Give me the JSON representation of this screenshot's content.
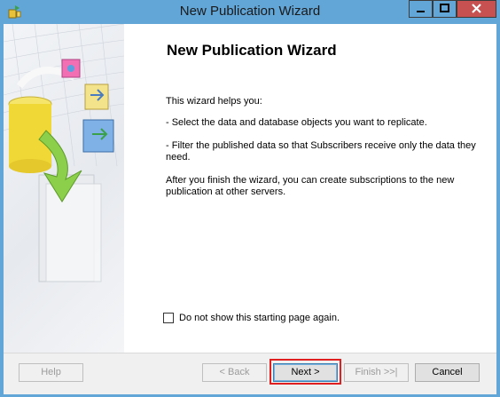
{
  "window": {
    "title": "New Publication Wizard"
  },
  "content": {
    "heading": "New Publication Wizard",
    "intro": "This wizard helps you:",
    "bullet1": "- Select the data and database objects you want to replicate.",
    "bullet2": "- Filter the published data so that Subscribers receive only the data they need.",
    "outro": "After you finish the wizard, you can create subscriptions to the new publication at other servers.",
    "checkbox_label": "Do not show this starting page again.",
    "checkbox_checked": false
  },
  "buttons": {
    "help": "Help",
    "back": "< Back",
    "next": "Next >",
    "finish": "Finish >>|",
    "cancel": "Cancel"
  },
  "colors": {
    "titlebar": "#62a5d7",
    "close": "#c75050",
    "highlight": "#e02020"
  }
}
